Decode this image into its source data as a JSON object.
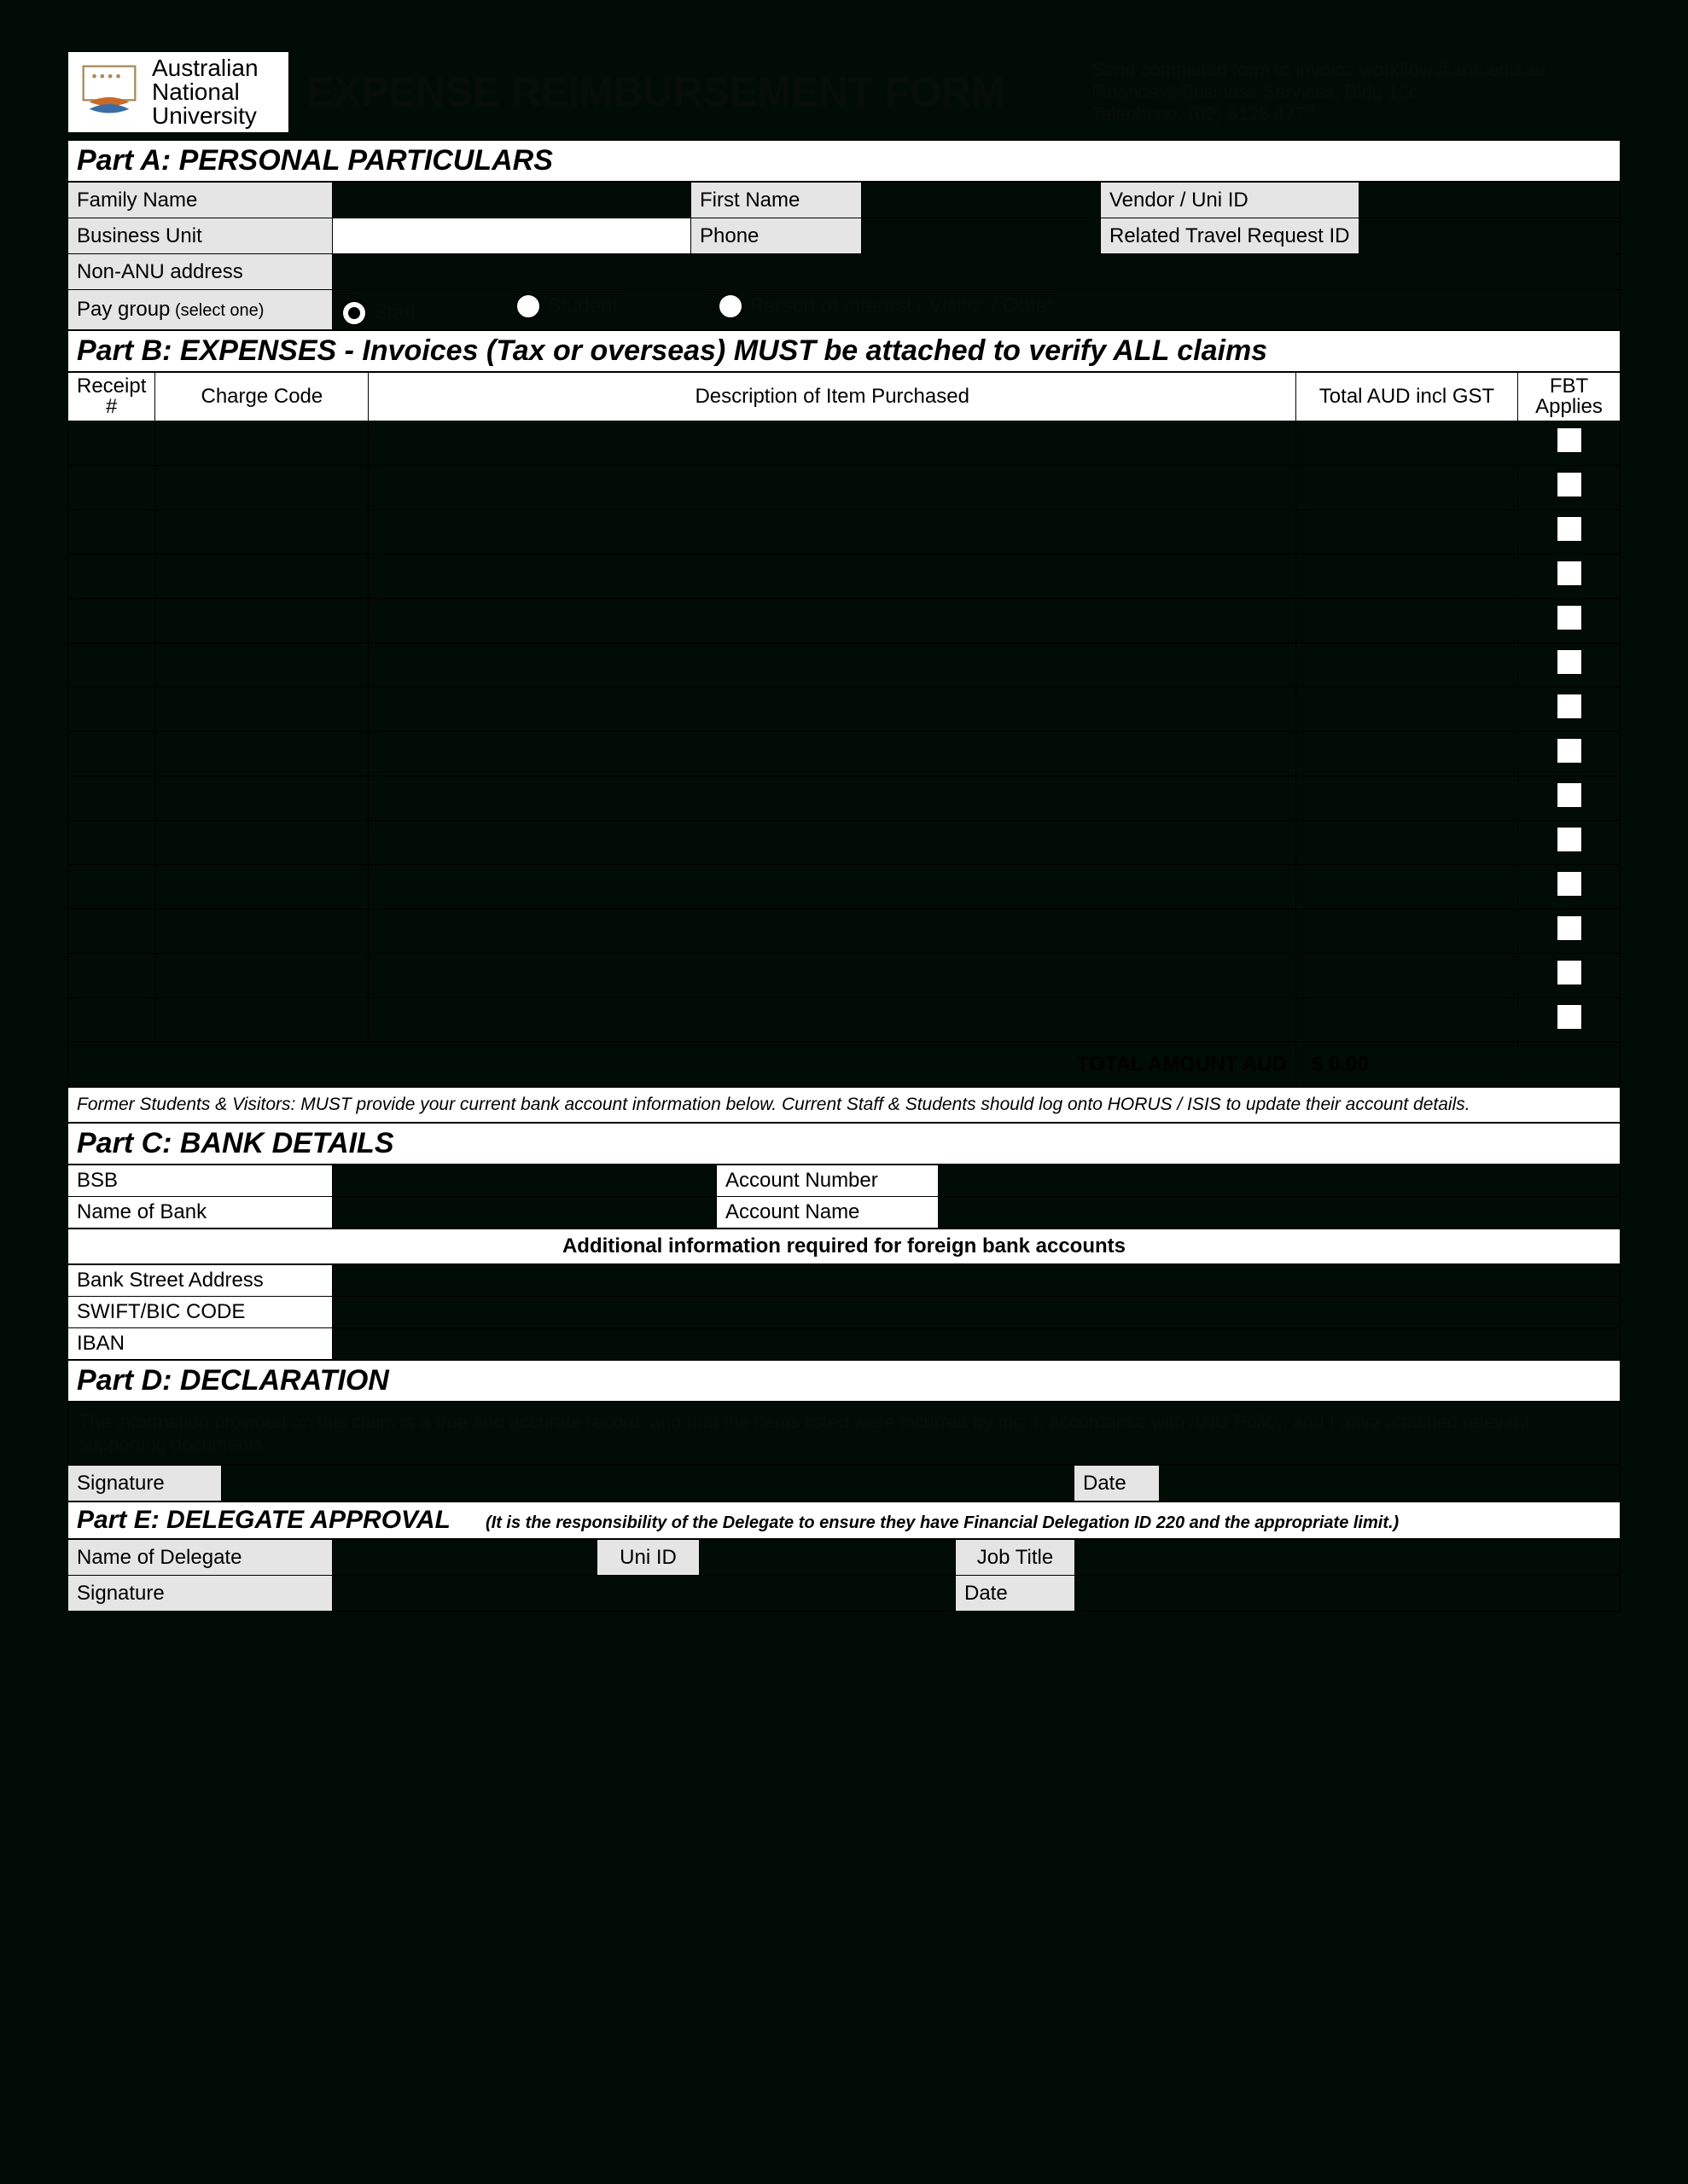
{
  "header": {
    "logo_line1": "Australian",
    "logo_line2": "National",
    "logo_line3": "University",
    "title": "EXPENSE REIMBURSEMENT FORM",
    "submit_line1": "Send completed form to invoice.workflow@anu.edu.au",
    "submit_line2": "Finance & Business Services, Bldg 10c",
    "submit_line3": "Telephone: (02) 6125 4777"
  },
  "partA": {
    "title": "Part A: PERSONAL PARTICULARS",
    "family_name": "Family Name",
    "first_name": "First Name",
    "vendor": "Vendor  /  Uni ID",
    "business_unit": "Business Unit",
    "phone": "Phone",
    "travel_id": "Related Travel Request ID",
    "non_anu": "Non-ANU address",
    "paygroup_label": "Pay group",
    "paygroup_hint": " (select one)",
    "opt_staff": "Staff",
    "opt_student": "Student",
    "opt_other": "Person of Interest / Visitor / Other"
  },
  "partB": {
    "title": "Part B: EXPENSES - Invoices (Tax or overseas) MUST be attached to verify ALL claims",
    "col_receipt": "Receipt #",
    "col_charge": "Charge Code",
    "col_desc": "Description of Item Purchased",
    "col_total": "Total AUD incl GST",
    "col_fbt": "FBT Applies",
    "total_label": "TOTAL AMOUNT AUD",
    "total_value": "$ 0.00",
    "note": "Former Students & Visitors: MUST provide your current bank account information below. Current Staff & Students should log onto HORUS / ISIS to update their account details."
  },
  "partC": {
    "title": "Part C: BANK DETAILS",
    "bsb": "BSB",
    "account_number": "Account Number",
    "name_of_bank": "Name of Bank",
    "account_name": "Account Name",
    "foreign": "Additional information required for foreign bank accounts",
    "bank_addr": "Bank Street Address",
    "swift": "SWIFT/BIC CODE",
    "iban": "IBAN"
  },
  "partD": {
    "title": "Part D: DECLARATION",
    "text": "The information provided on this claim is a true and accurate record, and that the items listed were incurred by me in accordance with ANU Policy, and I have attached relevant supporting documents.",
    "signature": "Signature",
    "date": "Date"
  },
  "partE": {
    "title": "Part E: DELEGATE APPROVAL",
    "note": "(It is the responsibility of the Delegate to ensure they have Financial Delegation ID 220 and the appropriate limit.)",
    "name": "Name of Delegate",
    "uni_id": "Uni ID",
    "job_title": "Job Title",
    "signature": "Signature",
    "date": "Date"
  }
}
